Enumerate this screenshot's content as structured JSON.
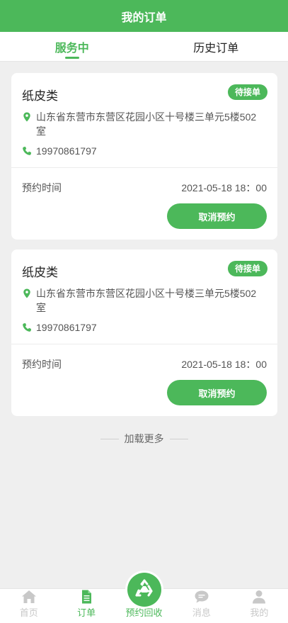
{
  "header": {
    "title": "我的订单"
  },
  "tabs": [
    {
      "label": "服务中",
      "active": true
    },
    {
      "label": "历史订单",
      "active": false
    }
  ],
  "orders": [
    {
      "category": "纸皮类",
      "status": "待接单",
      "address": "山东省东营市东营区花园小区十号楼三单元5楼502室",
      "phone": "19970861797",
      "time_label": "预约时间",
      "time_value": "2021-05-18 18：00",
      "cancel_label": "取消预约"
    },
    {
      "category": "纸皮类",
      "status": "待接单",
      "address": "山东省东营市东营区花园小区十号楼三单元5楼502室",
      "phone": "19970861797",
      "time_label": "预约时间",
      "time_value": "2021-05-18 18：00",
      "cancel_label": "取消预约"
    }
  ],
  "load_more": "加载更多",
  "tabbar": {
    "items": [
      {
        "label": "首页",
        "icon": "home-icon"
      },
      {
        "label": "订单",
        "icon": "order-icon",
        "active": true
      },
      {
        "label": "预约回收",
        "icon": "recycle-icon"
      },
      {
        "label": "消息",
        "icon": "message-icon"
      },
      {
        "label": "我的",
        "icon": "user-icon"
      }
    ]
  },
  "colors": {
    "accent": "#4cb85a",
    "background": "#efefef"
  }
}
